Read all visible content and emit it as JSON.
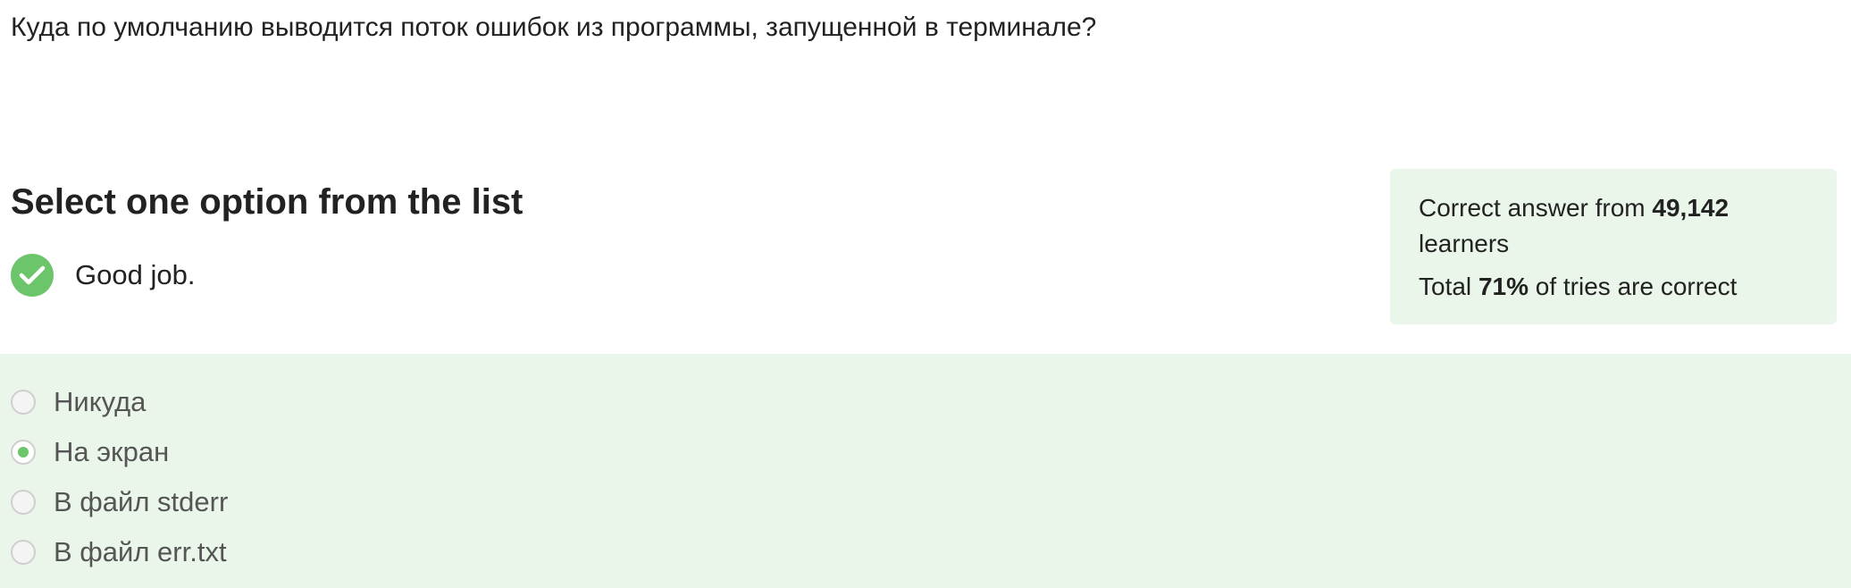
{
  "question": {
    "text": "Куда по умолчанию выводится поток ошибок из программы, запущенной в терминале?"
  },
  "instruction": "Select one option from the list",
  "feedback": {
    "icon": "check-icon",
    "text": "Good job.",
    "color": "#6cc56a"
  },
  "stats": {
    "correct_prefix": "Correct answer from ",
    "learners_count": "49,142",
    "learners_suffix": "learners",
    "total_prefix": "Total ",
    "percent": "71%",
    "total_suffix": " of tries are correct"
  },
  "options": [
    {
      "label": "Никуда",
      "selected": false
    },
    {
      "label": "На экран",
      "selected": true
    },
    {
      "label": "В файл stderr",
      "selected": false
    },
    {
      "label": "В файл err.txt",
      "selected": false
    }
  ],
  "colors": {
    "accent": "#6cc56a",
    "panel_background": "#ebf6ea"
  }
}
